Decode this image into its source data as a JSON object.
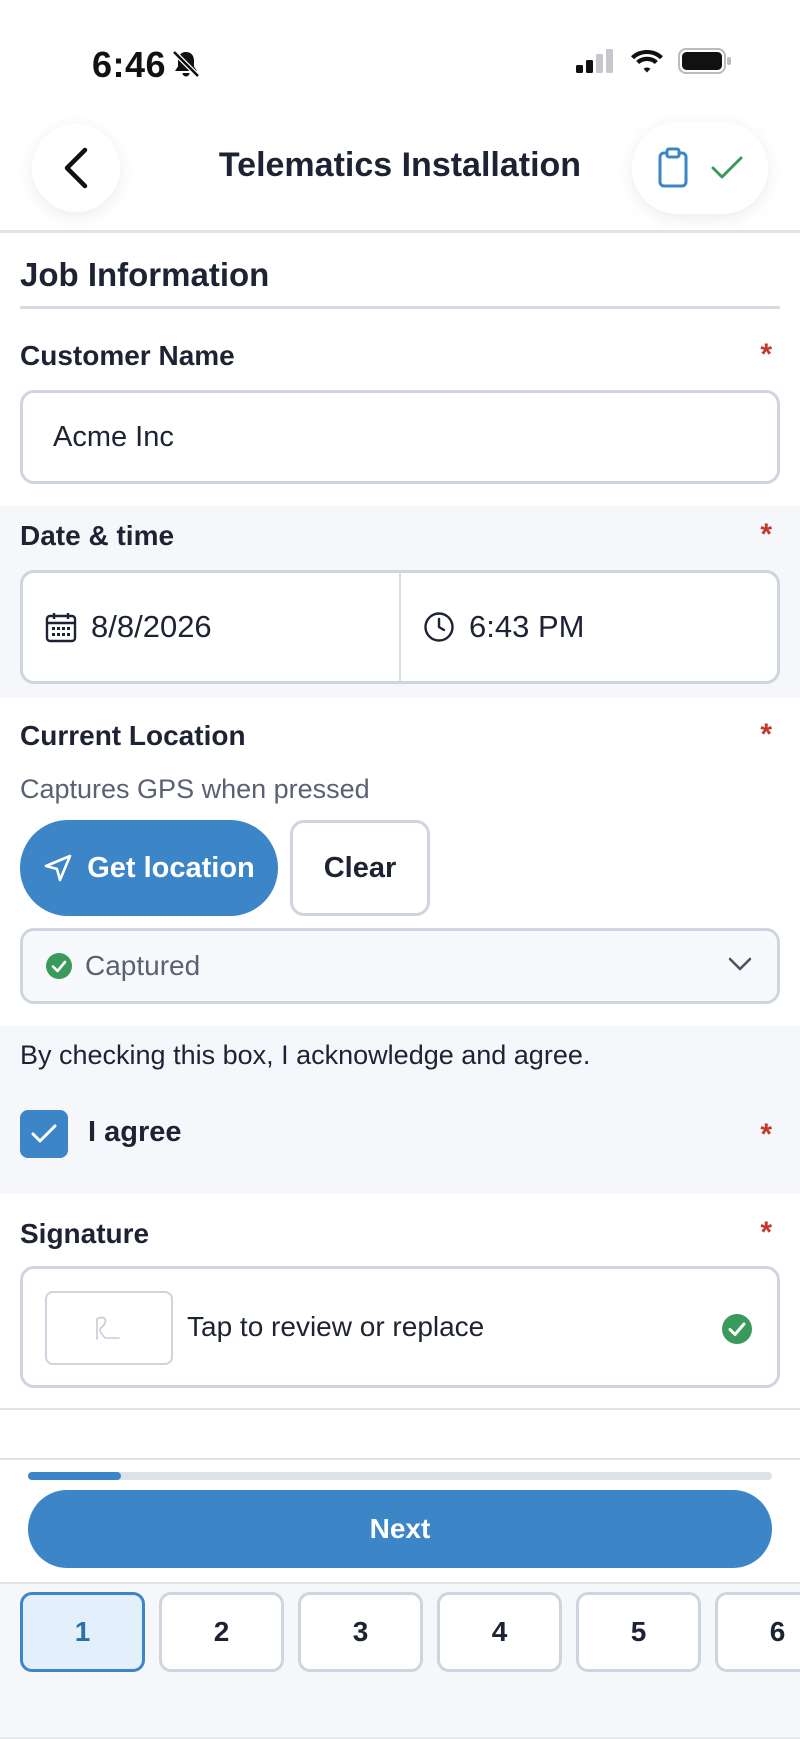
{
  "status_bar": {
    "time": "6:46"
  },
  "header": {
    "title": "Telematics Installation"
  },
  "section": {
    "title": "Job Information"
  },
  "customer": {
    "label": "Customer Name",
    "value": "Acme Inc",
    "required": "*"
  },
  "datetime": {
    "label": "Date & time",
    "date": "8/8/2026",
    "time": "6:43 PM",
    "required": "*"
  },
  "location": {
    "label": "Current Location",
    "helper": "Captures GPS when pressed",
    "get_label": "Get location",
    "clear_label": "Clear",
    "status": "Captured",
    "required": "*"
  },
  "agreement": {
    "text": "By checking this box, I acknowledge and agree.",
    "label": "I agree",
    "checked": true,
    "required": "*"
  },
  "signature": {
    "label": "Signature",
    "hint": "Tap to review or replace",
    "required": "*"
  },
  "progress": {
    "fraction": 0.125
  },
  "footer": {
    "next_label": "Next"
  },
  "steps": {
    "items": [
      "1",
      "2",
      "3",
      "4",
      "5",
      "6"
    ],
    "active_index": 0
  },
  "colors": {
    "accent": "#3c85c6",
    "success": "#3a9a5b",
    "required": "#c0392b"
  }
}
